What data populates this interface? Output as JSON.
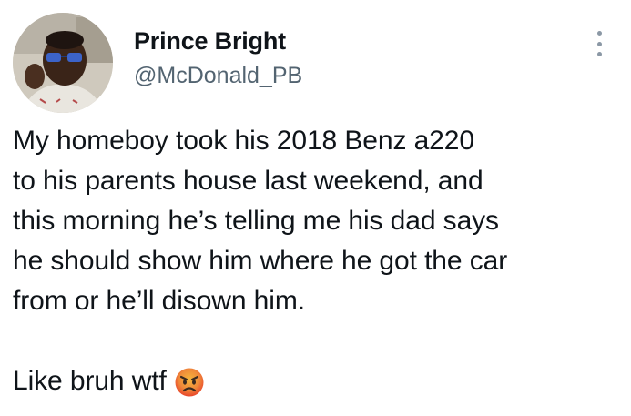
{
  "author": {
    "display_name": "Prince Bright",
    "handle": "@McDonald_PB",
    "avatar_icon": "profile-photo",
    "more_icon": "more-vertical-icon"
  },
  "tweet": {
    "lines": [
      "My homeboy took his 2018 Benz a220",
      "to his parents house last weekend, and",
      "this morning he’s telling me his dad says",
      "he should show him where he got the car",
      "from or he’ll disown him."
    ],
    "final_line": "Like bruh wtf",
    "emoji": "angry-face-emoji"
  },
  "colors": {
    "text": "#0f1419",
    "secondary": "#536471",
    "emoji_face": "#f0a030",
    "emoji_red": "#e8452b"
  }
}
